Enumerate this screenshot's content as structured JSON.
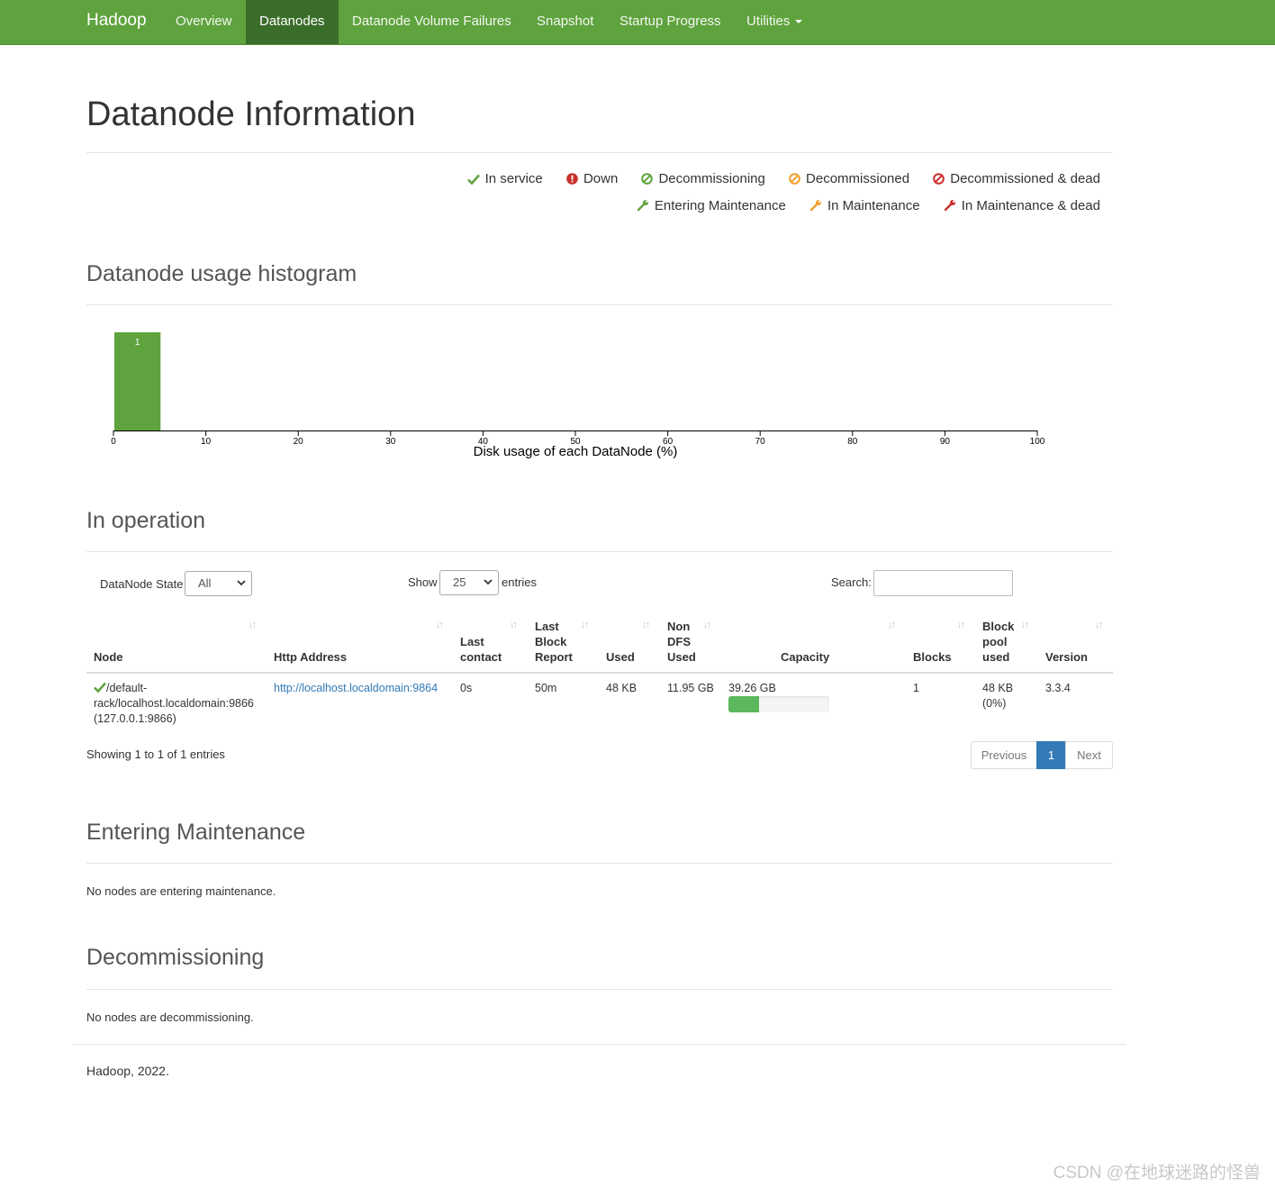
{
  "navbar": {
    "brand": "Hadoop",
    "items": [
      "Overview",
      "Datanodes",
      "Datanode Volume Failures",
      "Snapshot",
      "Startup Progress",
      "Utilities"
    ],
    "active": "Datanodes",
    "color": "#5fa33e"
  },
  "page_title": "Datanode Information",
  "legend": {
    "row1": [
      "In service",
      "Down",
      "Decommissioning",
      "Decommissioned",
      "Decommissioned & dead"
    ],
    "row2": [
      "Entering Maintenance",
      "In Maintenance",
      "In Maintenance & dead"
    ]
  },
  "histogram": {
    "heading": "Datanode usage histogram",
    "chart_data": {
      "type": "bar",
      "xlabel": "Disk usage of each DataNode (%)",
      "xlim": [
        0,
        100
      ],
      "ticks": [
        0,
        10,
        20,
        30,
        40,
        50,
        60,
        70,
        80,
        90,
        100
      ],
      "bins": [
        {
          "from": 0,
          "to": 5,
          "count": 1
        }
      ],
      "bar_color": "#5fa33e"
    }
  },
  "operation": {
    "heading": "In operation",
    "state_label": "DataNode State",
    "state_value": "All",
    "show_label": "Show",
    "show_value": "25",
    "entries_label": "entries",
    "search_label": "Search:",
    "columns": {
      "node": "Node",
      "http": "Http Address",
      "last_contact": [
        "Last",
        "contact"
      ],
      "last_block": [
        "Last",
        "Block",
        "Report"
      ],
      "used": "Used",
      "non_dfs": [
        "Non",
        "DFS",
        "Used"
      ],
      "capacity": "Capacity",
      "blocks": "Blocks",
      "block_pool": [
        "Block",
        "pool",
        "used"
      ],
      "version": "Version"
    },
    "row": {
      "node_line1": "/default-",
      "node_line2": "rack/localhost.localdomain:9866",
      "node_line3": "(127.0.0.1:9866)",
      "http": "http://localhost.localdomain:9864",
      "last_contact": "0s",
      "last_block": "50m",
      "used": "48 KB",
      "non_dfs": "11.95 GB",
      "capacity": "39.26 GB",
      "capacity_used_fraction": 0.3,
      "blocks": "1",
      "block_pool_line1": "48 KB",
      "block_pool_line2": "(0%)",
      "version": "3.3.4"
    },
    "info": "Showing 1 to 1 of 1 entries",
    "pagination": {
      "previous": "Previous",
      "page": "1",
      "next": "Next"
    }
  },
  "entering_maintenance": {
    "heading": "Entering Maintenance",
    "note": "No nodes are entering maintenance."
  },
  "decommissioning": {
    "heading": "Decommissioning",
    "note": "No nodes are decommissioning."
  },
  "footer": "Hadoop, 2022.",
  "watermark": "CSDN @在地球迷路的怪兽"
}
